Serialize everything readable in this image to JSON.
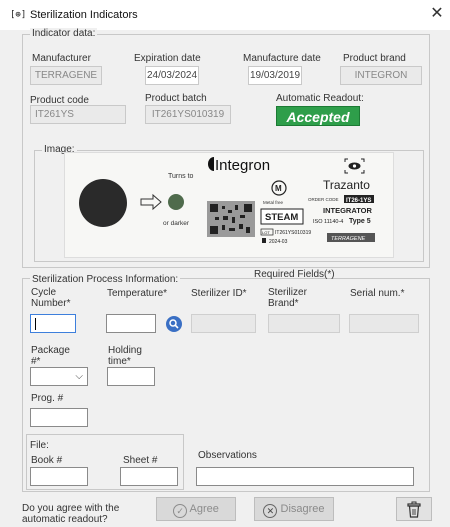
{
  "window": {
    "title": "Sterilization Indicators",
    "app_icon": "[⊕]",
    "close_glyph": "✕"
  },
  "indicator_data": {
    "legend": "Indicator data:",
    "manufacturer": {
      "label": "Manufacturer",
      "value": "TERRAGENE"
    },
    "expiration_date": {
      "label": "Expiration date",
      "value": "24/03/2024"
    },
    "manufacture_date": {
      "label": "Manufacture date",
      "value": "19/03/2019"
    },
    "product_brand": {
      "label": "Product brand",
      "value": "INTEGRON"
    },
    "product_code": {
      "label": "Product code",
      "value": "IT261YS"
    },
    "product_batch": {
      "label": "Product batch",
      "value": "IT261YS010319"
    },
    "automatic_readout": {
      "label": "Automatic Readout:",
      "value": "Accepted"
    },
    "image_legend": "Image:"
  },
  "indicator_image": {
    "brand": "Integron",
    "turns_to": "Turns to",
    "or_darker": "or darker",
    "metal_free_symbol": "M",
    "metal_free": "Metal free",
    "steam": "STEAM",
    "lot": "IT261YS010319",
    "lot_prefix": "LOT",
    "date": "2024-03",
    "trazanto": "Trazanto",
    "order_code_label": "ORDER CODE",
    "order_code": "IT26-1YS",
    "integrator": "INTEGRATOR",
    "iso": "ISO 11140-4",
    "type": "Type 5",
    "maker": "TERRAGENE",
    "colors": {
      "dot_dark": "#2a2a2a",
      "dot_green": "#4f6b4c",
      "steam_bg": "#ffffff"
    }
  },
  "process": {
    "legend": "Sterilization Process Information:",
    "required_note": "Required Fields(*)",
    "cycle_number_label": "Cycle Number*",
    "temperature_label": "Temperature*",
    "sterilizer_id_label": "Sterilizer ID*",
    "sterilizer_brand_label": "Sterilizer Brand*",
    "serial_num_label": "Serial num.*",
    "package_label": "Package #*",
    "holding_time_label": "Holding time*",
    "prog_label": "Prog. #",
    "file_legend": "File:",
    "book_label": "Book #",
    "sheet_label": "Sheet #",
    "observations_label": "Observations"
  },
  "footer": {
    "question": "Do you agree with the automatic readout?",
    "agree": "Agree",
    "disagree": "Disagree"
  },
  "colors": {
    "accepted_green": "#2e9e4a",
    "focus_blue": "#3d7fdc",
    "search_blue": "#3a6fc4"
  },
  "icons": [
    "app-icon",
    "close-icon",
    "search-icon",
    "check-circle-icon",
    "x-circle-icon",
    "trash-icon",
    "chevron-down-icon"
  ]
}
